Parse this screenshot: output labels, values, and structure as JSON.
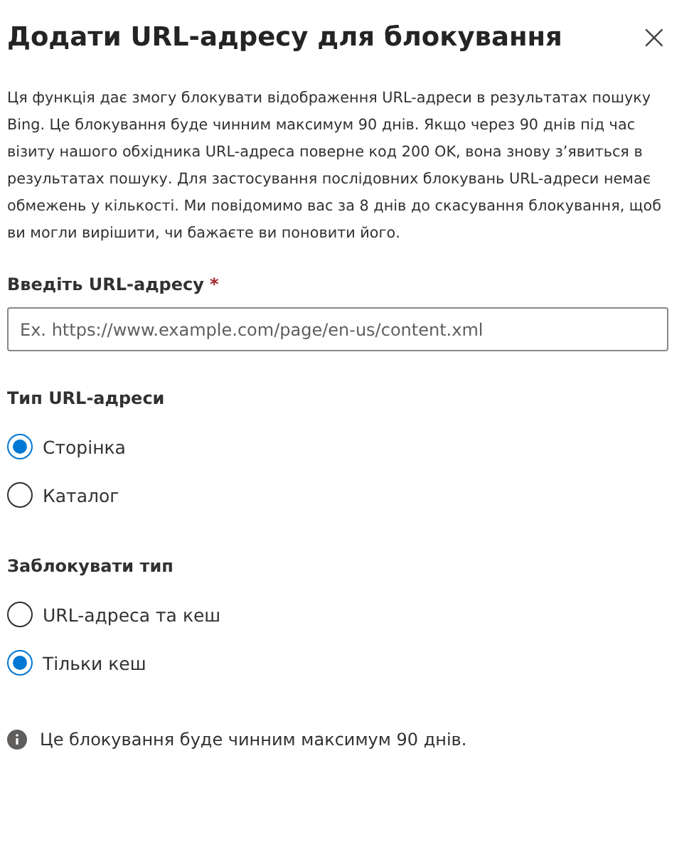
{
  "dialog": {
    "title": "Додати URL-адресу для блокування",
    "close": "×"
  },
  "description": "Ця функція дає змогу блокувати відображення URL-адреси в результатах пошуку Bing. Це блокування буде чинним максимум 90 днів. Якщо через 90 днів під час візиту нашого обхідника URL-адреса поверне код 200 OK, вона знову з’явиться в результатах пошуку. Для застосування послідовних блокувань URL-адреси немає обмежень у кількості. Ми повідомимо вас за 8 днів до скасування блокування, щоб ви могли вирішити, чи бажаєте ви поновити його.",
  "url_field": {
    "label": "Введіть URL-адресу",
    "required_mark": "*",
    "placeholder": "Ex. https://www.example.com/page/en-us/content.xml"
  },
  "groups": [
    {
      "label": "Тип URL-адреси",
      "options": [
        {
          "label": "Сторінка",
          "selected": true
        },
        {
          "label": "Каталог",
          "selected": false
        }
      ]
    },
    {
      "label": "Заблокувати тип",
      "options": [
        {
          "label": "URL-адреса та кеш",
          "selected": false
        },
        {
          "label": "Тільки кеш",
          "selected": true
        }
      ]
    }
  ],
  "info": "Це блокування буде чинним максимум 90 днів."
}
